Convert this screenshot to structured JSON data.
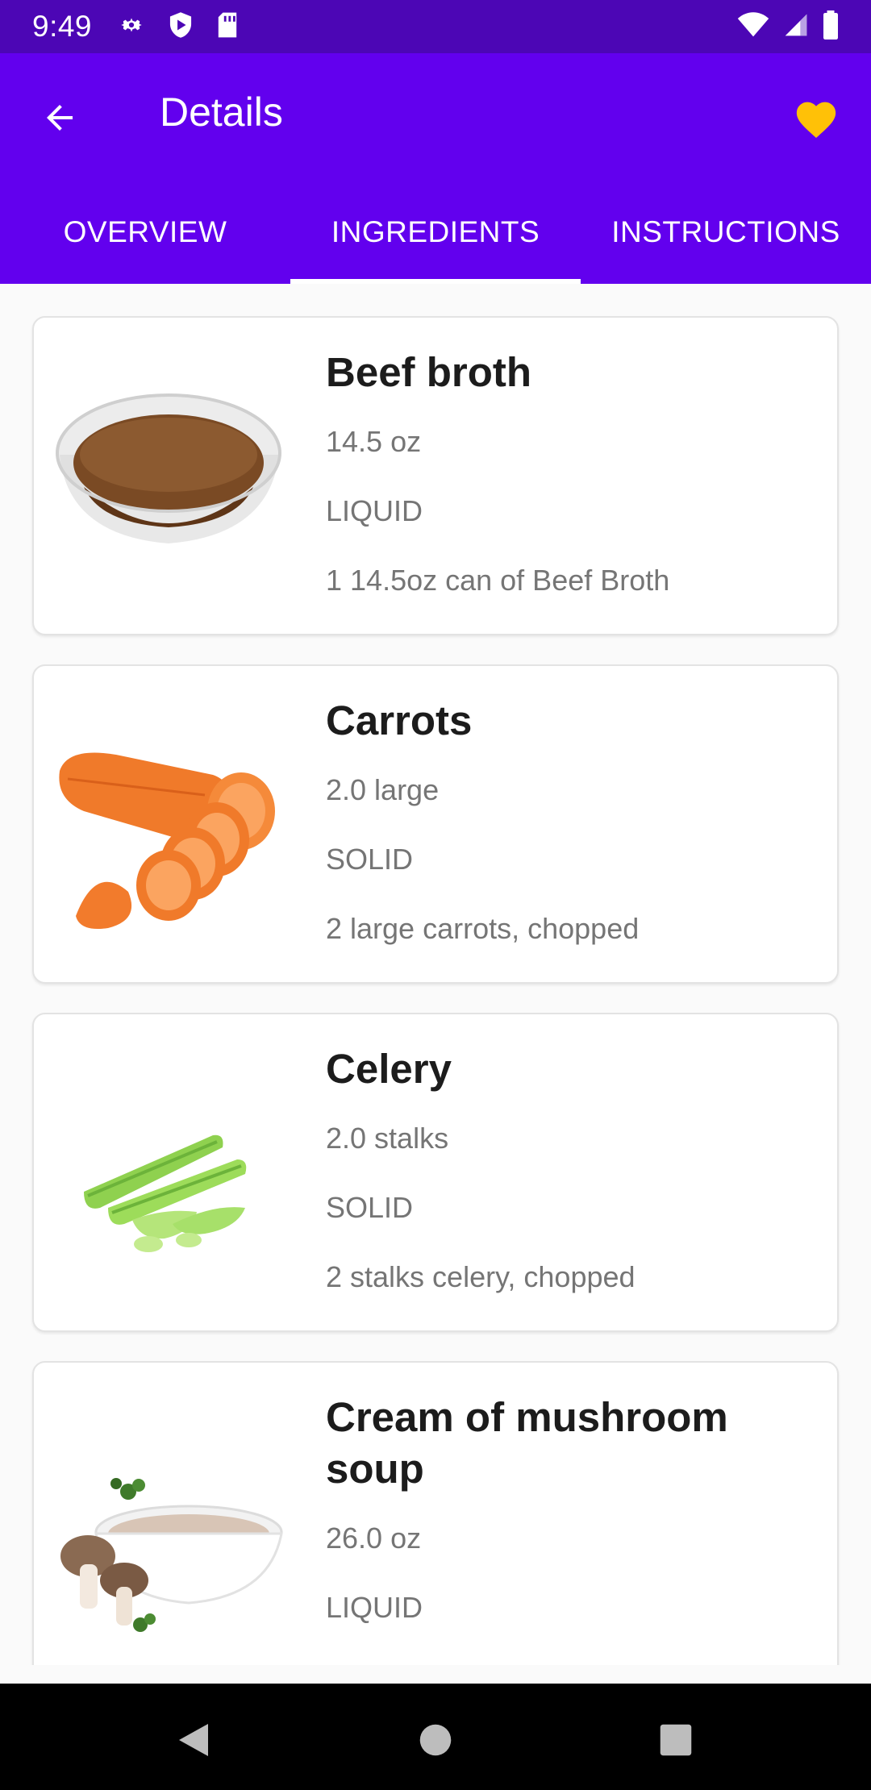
{
  "status_bar": {
    "time": "9:49",
    "icons_left": [
      "settings-icon",
      "shield-icon",
      "sd-card-icon"
    ],
    "icons_right": [
      "wifi-icon",
      "signal-icon",
      "battery-icon"
    ]
  },
  "appbar": {
    "title": "Details",
    "back_icon": "arrow-back-icon",
    "favorite_icon": "heart-icon",
    "favorite_color": "#ffc107"
  },
  "tabs": [
    {
      "label": "OVERVIEW",
      "active": false
    },
    {
      "label": "INGREDIENTS",
      "active": true
    },
    {
      "label": "INSTRUCTIONS",
      "active": false
    }
  ],
  "ingredients": [
    {
      "name": "Beef broth",
      "amount": "14.5  oz",
      "consistency": "LIQUID",
      "original": "1 14.5oz can of Beef Broth",
      "image": "beef-broth-bowl"
    },
    {
      "name": "Carrots",
      "amount": "2.0  large",
      "consistency": "SOLID",
      "original": "2 large carrots, chopped",
      "image": "carrots"
    },
    {
      "name": "Celery",
      "amount": "2.0  stalks",
      "consistency": "SOLID",
      "original": "2 stalks celery, chopped",
      "image": "celery"
    },
    {
      "name": "Cream of mushroom soup",
      "amount": "26.0  oz",
      "consistency": "LIQUID",
      "original": "",
      "image": "mushroom-soup"
    }
  ],
  "colors": {
    "primary": "#6200ee",
    "status_bar": "#4c06b5",
    "accent_heart": "#ffc107"
  }
}
